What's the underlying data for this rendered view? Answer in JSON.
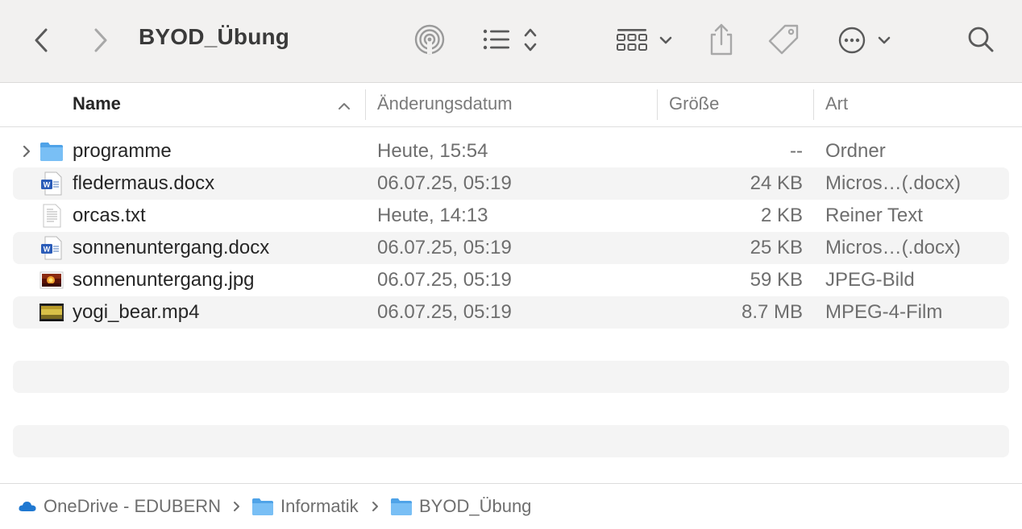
{
  "window": {
    "title": "BYOD_Übung"
  },
  "toolbar": {
    "back_icon": "chevron-left-icon",
    "forward_icon": "chevron-right-icon",
    "airdrop_icon": "airdrop-icon",
    "view_icon": "list-view-icon",
    "group_icon": "group-grid-icon",
    "share_icon": "share-icon",
    "tag_icon": "tag-icon",
    "more_icon": "ellipsis-circle-icon",
    "search_icon": "magnifier-icon"
  },
  "columns": {
    "name": "Name",
    "date": "Änderungsdatum",
    "size": "Größe",
    "kind": "Art",
    "sort": "ascending"
  },
  "files": [
    {
      "name": "programme",
      "date": "Heute, 15:54",
      "size": "--",
      "kind": "Ordner",
      "icon": "folder-icon",
      "expandable": true
    },
    {
      "name": "fledermaus.docx",
      "date": "06.07.25, 05:19",
      "size": "24 KB",
      "kind": "Micros…(.docx)",
      "icon": "word-document-icon"
    },
    {
      "name": "orcas.txt",
      "date": "Heute, 14:13",
      "size": "2 KB",
      "kind": "Reiner Text",
      "icon": "text-document-icon"
    },
    {
      "name": "sonnenuntergang.docx",
      "date": "06.07.25, 05:19",
      "size": "25 KB",
      "kind": "Micros…(.docx)",
      "icon": "word-document-icon"
    },
    {
      "name": "sonnenuntergang.jpg",
      "date": "06.07.25, 05:19",
      "size": "59 KB",
      "kind": "JPEG-Bild",
      "icon": "image-thumbnail-icon"
    },
    {
      "name": "yogi_bear.mp4",
      "date": "06.07.25, 05:19",
      "size": "8.7 MB",
      "kind": "MPEG-4-Film",
      "icon": "video-thumbnail-icon"
    }
  ],
  "pathbar": {
    "items": [
      {
        "label": "OneDrive - EDUBERN",
        "icon": "cloud-icon"
      },
      {
        "label": "Informatik",
        "icon": "folder-icon"
      },
      {
        "label": "BYOD_Übung",
        "icon": "folder-icon"
      }
    ]
  },
  "colors": {
    "toolbar_bg": "#f2f1f0",
    "folder_blue": "#5aaef0",
    "stripe": "#f4f4f4",
    "secondary_text": "#6e6e6e",
    "onedrive_blue": "#1f78d1"
  }
}
